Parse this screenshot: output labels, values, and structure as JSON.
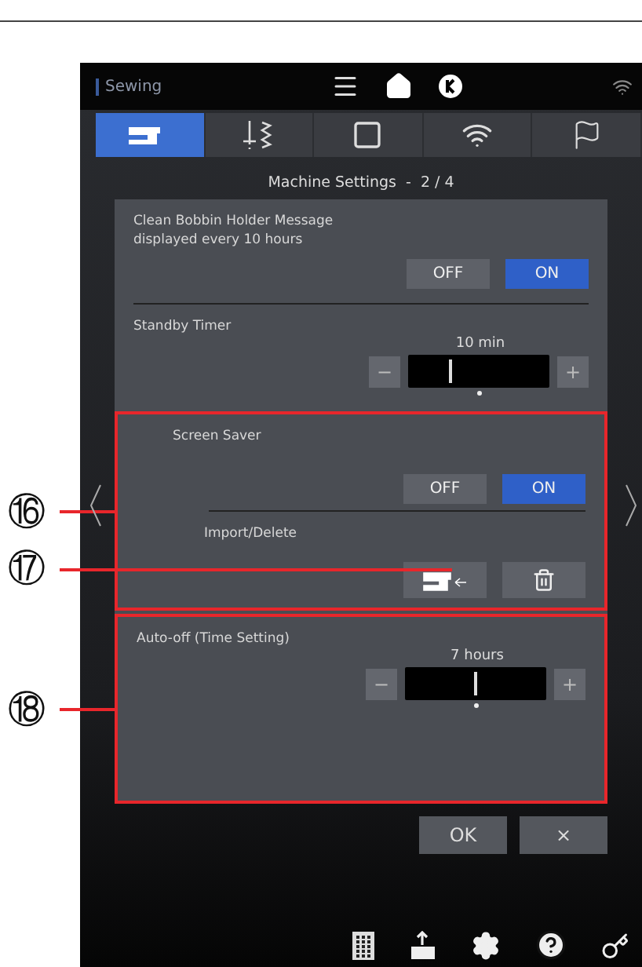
{
  "header": {
    "title": "Sewing"
  },
  "tabs": [
    {
      "kind": "machine",
      "selected": true
    },
    {
      "kind": "stitch",
      "selected": false
    },
    {
      "kind": "frame",
      "selected": false
    },
    {
      "kind": "wireless",
      "selected": false
    },
    {
      "kind": "flag",
      "selected": false
    }
  ],
  "page_title": "Machine Settings  -  2 / 4",
  "sections": [
    {
      "framed": false,
      "items": [
        {
          "kind": "toggle",
          "label": "Clean Bobbin Holder Message displayed every 10 hours",
          "options": [
            {
              "label": "OFF",
              "selected": false
            },
            {
              "label": "ON",
              "selected": true
            }
          ]
        },
        {
          "kind": "slider",
          "label": "Standby Timer",
          "reading": "10 min",
          "minus": "−",
          "plus": "+",
          "level": 0.3
        }
      ]
    },
    {
      "framed": true,
      "callout": "⑯",
      "items": [
        {
          "kind": "toggle",
          "label": "Screen Saver",
          "indent": true,
          "options": [
            {
              "label": "OFF",
              "selected": false
            },
            {
              "label": "ON",
              "selected": true
            }
          ]
        },
        {
          "kind": "actions",
          "label": "Import/Delete",
          "callout": "⑰"
        }
      ]
    },
    {
      "framed": true,
      "callout": "⑱",
      "items": [
        {
          "kind": "slider",
          "label": "Auto-off (Time Setting)",
          "reading": "7 hours",
          "minus": "−",
          "plus": "+",
          "level": 0.5
        }
      ]
    }
  ],
  "buttons": [
    "OK",
    "×"
  ]
}
